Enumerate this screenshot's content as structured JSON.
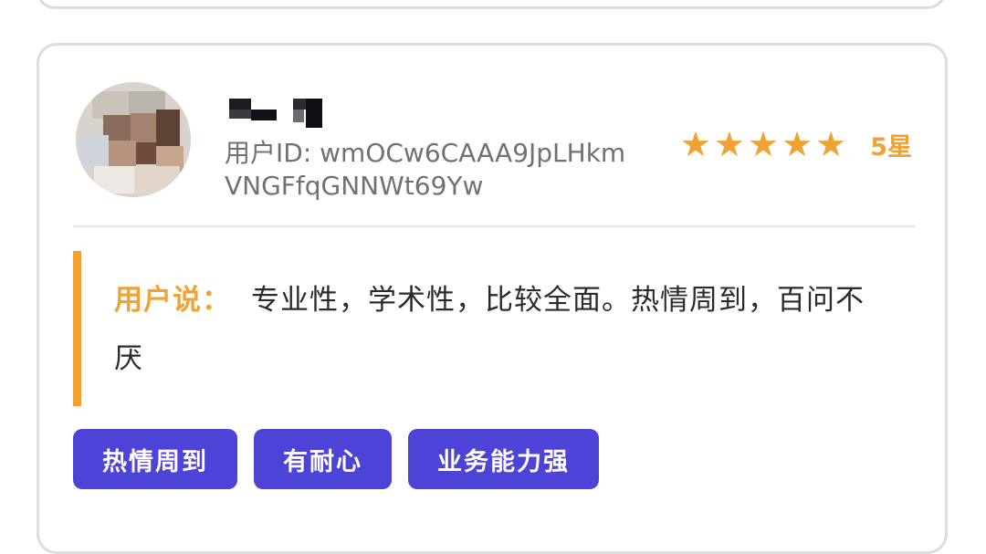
{
  "review": {
    "user_id_text": "用户ID: wmOCw6CAAA9JpLHkmVNGFfqGNNWt69Yw",
    "stars": [
      "★",
      "★",
      "★",
      "★",
      "★"
    ],
    "rating_label": "5星",
    "quote_label": "用户说：",
    "quote_text": "专业性，学术性，比较全面。热情周到，百问不厌",
    "tags": [
      "热情周到",
      "有耐心",
      "业务能力强"
    ]
  },
  "colors": {
    "accent_orange": "#f0a335",
    "tag_purple": "#4d43d6",
    "card_border": "#dcdde2"
  },
  "icons": {
    "avatar": "pixelated-avatar-image",
    "star": "star-icon"
  }
}
